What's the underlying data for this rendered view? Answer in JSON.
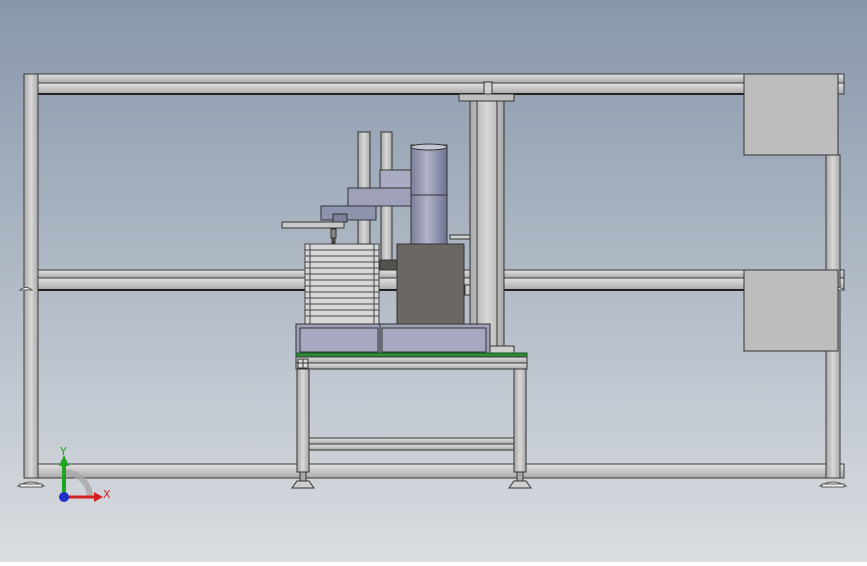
{
  "triad": {
    "y_label": "Y",
    "x_label": "X"
  },
  "colors": {
    "bg_top": "#8a99ac",
    "bg_bottom": "#d9dde1",
    "frame": "#c9c9c9",
    "frame_dark": "#9a9a9a",
    "outline": "#333333",
    "panel": "#bdbdbd",
    "robot_blue": "#8f93ad",
    "housing": "#6b6762",
    "green_plate": "#2e8b3a",
    "axis_y": "#22a322",
    "axis_x": "#d42020",
    "axis_z": "#2030c8"
  }
}
